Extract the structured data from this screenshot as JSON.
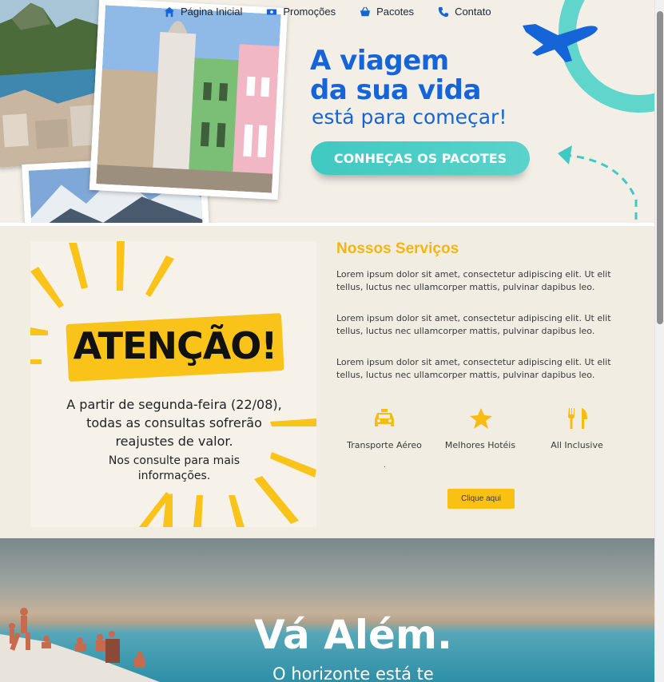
{
  "nav": [
    {
      "label": "Página Inicial",
      "icon": "home-icon"
    },
    {
      "label": "Promoções",
      "icon": "money-icon"
    },
    {
      "label": "Pacotes",
      "icon": "basket-icon"
    },
    {
      "label": "Contato",
      "icon": "phone-icon"
    }
  ],
  "hero": {
    "title_line1": "A viagem",
    "title_line2": "da sua vida",
    "title_line3": "está para começar!",
    "cta_label": "CONHEÇAS OS PACOTES"
  },
  "notice": {
    "title": "ATENÇÃO!",
    "text": "A partir de segunda-feira (22/08), todas as consultas sofrerão reajustes de valor.",
    "small": "Nos consulte para mais informações."
  },
  "services": {
    "title": "Nossos Serviços",
    "paragraphs": [
      "Lorem ipsum dolor sit amet, consectetur adipiscing elit. Ut elit tellus, luctus nec ullamcorper mattis, pulvinar dapibus leo.",
      "Lorem ipsum dolor sit amet, consectetur adipiscing elit. Ut elit tellus, luctus nec ullamcorper mattis, pulvinar dapibus leo.",
      "Lorem ipsum dolor sit amet, consectetur adipiscing elit. Ut elit tellus, luctus nec ullamcorper mattis, pulvinar dapibus leo."
    ],
    "items": [
      {
        "label": "Transporte Aéreo",
        "icon": "taxi-icon"
      },
      {
        "label": "Melhores Hotéis",
        "icon": "star-icon"
      },
      {
        "label": "All Inclusive",
        "icon": "utensils-icon"
      }
    ],
    "dot": ".",
    "button_label": "Clique aqui"
  },
  "beach": {
    "title": "Vá Além.",
    "subtitle": "O horizonte está te"
  },
  "colors": {
    "brand_blue": "#1565d8",
    "accent_yellow": "#f8c114",
    "teal": "#3fc9c1",
    "cream": "#f2ede3"
  }
}
